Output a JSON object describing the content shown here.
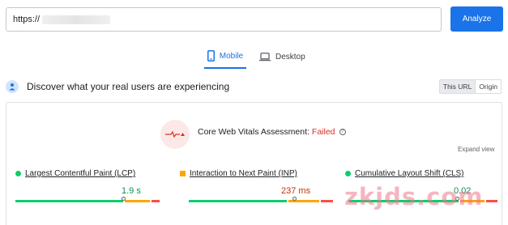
{
  "search": {
    "url_value": "https://",
    "analyze_label": "Analyze"
  },
  "tabs": [
    {
      "label": "Mobile"
    },
    {
      "label": "Desktop"
    }
  ],
  "discover": {
    "text": "Discover what your real users are experiencing",
    "this_url": "This URL",
    "origin": "Origin"
  },
  "assessment": {
    "prefix": "Core Web Vitals Assessment:",
    "status": "Failed",
    "expand": "Expand view"
  },
  "metrics": [
    {
      "label": "Largest Contentful Paint (LCP)",
      "value": "1.9 s",
      "status": "good"
    },
    {
      "label": "Interaction to Next Paint (INP)",
      "value": "237 ms",
      "status": "needs-improvement"
    },
    {
      "label": "Cumulative Layout Shift (CLS)",
      "value": "0.02",
      "status": "good"
    }
  ],
  "colors": {
    "accent": "#1a73e8",
    "good": "#0cce6b",
    "average": "#ffa400",
    "poor": "#ff4e42",
    "failed": "#d93025"
  },
  "watermark": "zkjds.com"
}
